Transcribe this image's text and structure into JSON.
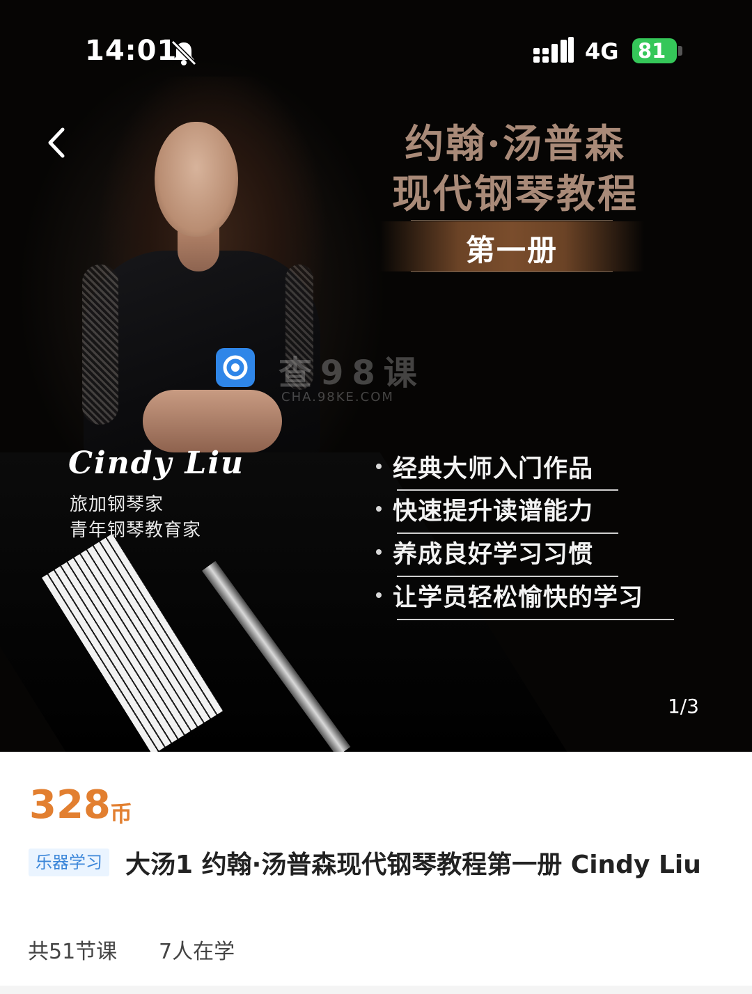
{
  "status_bar": {
    "time": "14:01",
    "network": "4G",
    "battery": "81",
    "icons": [
      "bell-muted-icon",
      "signal-icon",
      "battery-charging-icon"
    ]
  },
  "nav": {
    "back_icon": "chevron-left-icon"
  },
  "poster": {
    "title_line1": "约翰·汤普森",
    "title_line2": "现代钢琴教程",
    "volume": "第一册",
    "teacher_name": "Cindy Liu",
    "teacher_roles": [
      "旅加钢琴家",
      "青年钢琴教育家"
    ],
    "features": [
      "经典大师入门作品",
      "快速提升读谱能力",
      "养成良好学习习惯",
      "让学员轻松愉快的学习"
    ],
    "watermark_text": "查98课",
    "watermark_domain": "CHA.98KE.COM",
    "page_indicator": "1/3"
  },
  "course": {
    "price": "328",
    "price_unit": "币",
    "category": "乐器学习",
    "title": "大汤1 约翰·汤普森现代钢琴教程第一册 Cindy Liu",
    "lessons": "共51节课",
    "learners": "7人在学"
  },
  "colors": {
    "price": "#e27f30",
    "tag_bg": "#eaf4ff",
    "tag_text": "#3b86d9",
    "battery": "#35c759",
    "poster_title": "#a98a78"
  }
}
